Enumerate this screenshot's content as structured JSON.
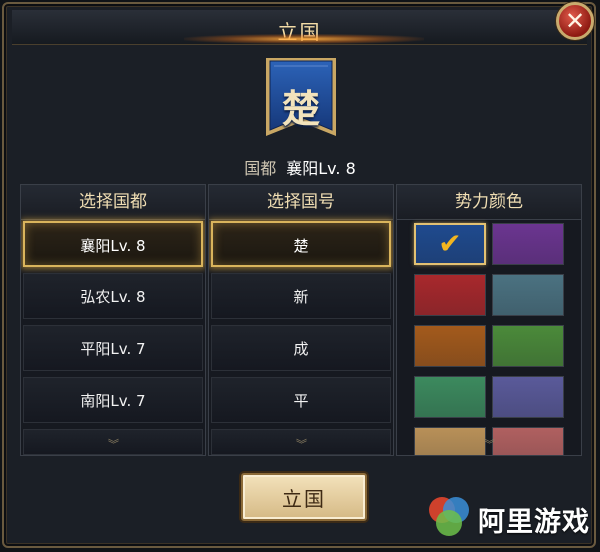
{
  "dialog": {
    "title": "立国",
    "close_icon": "close-icon"
  },
  "banner": {
    "character": "楚",
    "color": "#1f4f9a"
  },
  "capital": {
    "label": "国都",
    "value": "襄阳Lv. 8"
  },
  "columns": {
    "capital_header": "选择国都",
    "name_header": "选择国号",
    "color_header": "势力颜色"
  },
  "capitals": [
    {
      "label": "襄阳Lv. 8",
      "selected": true
    },
    {
      "label": "弘农Lv. 8",
      "selected": false
    },
    {
      "label": "平阳Lv. 7",
      "selected": false
    },
    {
      "label": "南阳Lv. 7",
      "selected": false
    }
  ],
  "names": [
    {
      "label": "楚",
      "selected": true
    },
    {
      "label": "新",
      "selected": false
    },
    {
      "label": "成",
      "selected": false
    },
    {
      "label": "平",
      "selected": false
    }
  ],
  "colors": [
    {
      "hex": "#1f4a8e",
      "selected": true
    },
    {
      "hex": "#6b3590",
      "selected": false
    },
    {
      "hex": "#a8282c",
      "selected": false
    },
    {
      "hex": "#4b7281",
      "selected": false
    },
    {
      "hex": "#a35a1c",
      "selected": false
    },
    {
      "hex": "#4b8a3a",
      "selected": false
    },
    {
      "hex": "#3c8a5e",
      "selected": false
    },
    {
      "hex": "#5a5a9a",
      "selected": false
    },
    {
      "hex": "#b89058",
      "selected": false
    },
    {
      "hex": "#b06060",
      "selected": false
    }
  ],
  "scroll_icon": "chevron-double-down-icon",
  "found_button": {
    "label": "立国"
  },
  "watermark": {
    "text": "阿里游戏",
    "logo_icon": "aligames-logo-icon"
  }
}
